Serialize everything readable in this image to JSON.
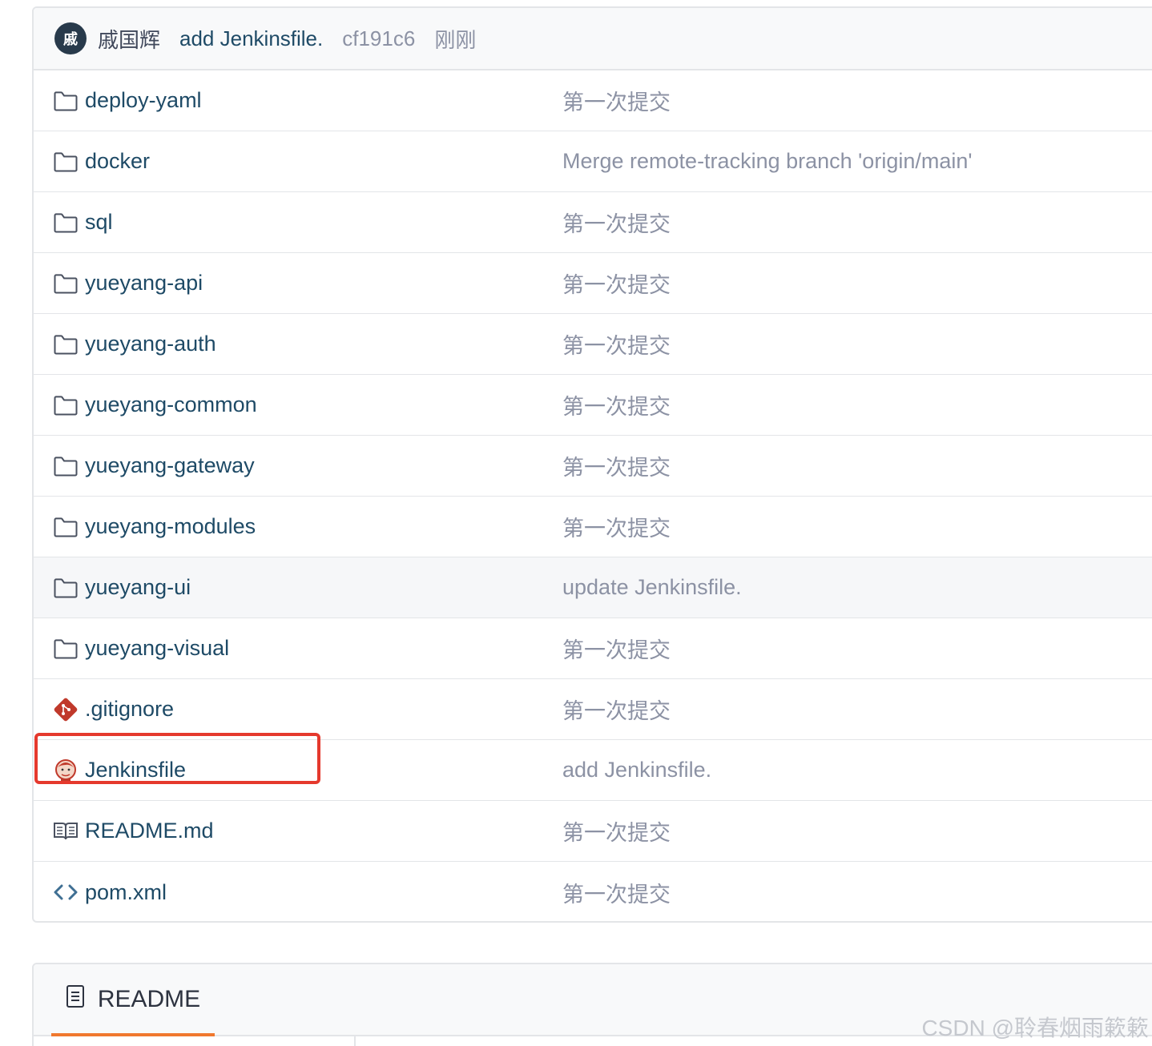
{
  "commit": {
    "avatar_char": "戚",
    "author": "戚国辉",
    "message": "add Jenkinsfile.",
    "sha": "cf191c6",
    "time": "刚刚"
  },
  "files": [
    {
      "name": "deploy-yaml",
      "message": "第一次提交",
      "icon": "folder-icon"
    },
    {
      "name": "docker",
      "message": "Merge remote-tracking branch 'origin/main'",
      "icon": "folder-icon"
    },
    {
      "name": "sql",
      "message": "第一次提交",
      "icon": "folder-icon"
    },
    {
      "name": "yueyang-api",
      "message": "第一次提交",
      "icon": "folder-icon"
    },
    {
      "name": "yueyang-auth",
      "message": "第一次提交",
      "icon": "folder-icon"
    },
    {
      "name": "yueyang-common",
      "message": "第一次提交",
      "icon": "folder-icon"
    },
    {
      "name": "yueyang-gateway",
      "message": "第一次提交",
      "icon": "folder-icon"
    },
    {
      "name": "yueyang-modules",
      "message": "第一次提交",
      "icon": "folder-icon"
    },
    {
      "name": "yueyang-ui",
      "message": "update Jenkinsfile.",
      "icon": "folder-icon"
    },
    {
      "name": "yueyang-visual",
      "message": "第一次提交",
      "icon": "folder-icon"
    },
    {
      "name": ".gitignore",
      "message": "第一次提交",
      "icon": "git-icon"
    },
    {
      "name": "Jenkinsfile",
      "message": "add Jenkinsfile.",
      "icon": "jenkins-icon"
    },
    {
      "name": "README.md",
      "message": "第一次提交",
      "icon": "book-icon"
    },
    {
      "name": "pom.xml",
      "message": "第一次提交",
      "icon": "code-icon"
    }
  ],
  "readme": {
    "tab_label": "README"
  },
  "watermark": "CSDN @聆春烟雨簌簌",
  "colors": {
    "link": "#1e4a66",
    "muted": "#8c92a4",
    "highlight": "#e5392d",
    "tab_underline": "#f0782e"
  }
}
